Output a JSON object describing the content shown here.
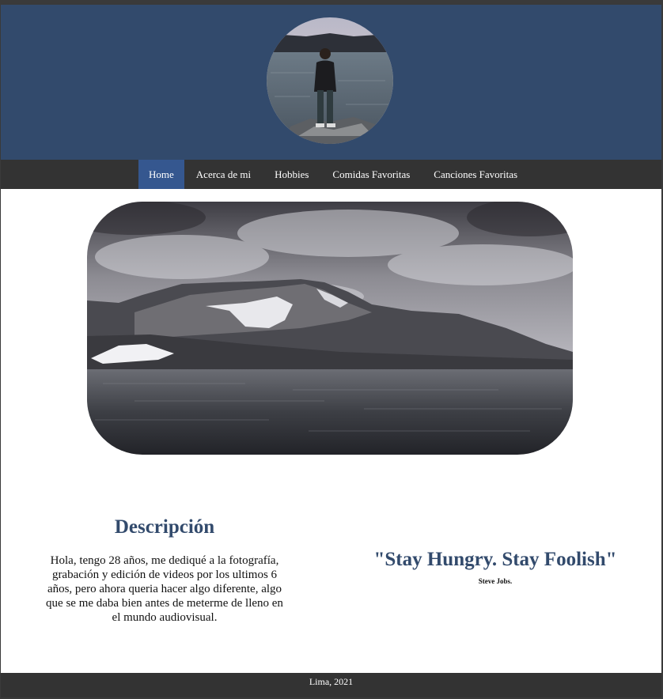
{
  "nav": {
    "items": [
      {
        "label": "Home",
        "active": true
      },
      {
        "label": "Acerca de mi",
        "active": false
      },
      {
        "label": "Hobbies",
        "active": false
      },
      {
        "label": "Comidas Favoritas",
        "active": false
      },
      {
        "label": "Canciones Favoritas",
        "active": false
      }
    ]
  },
  "description": {
    "title": "Descripción",
    "body": "Hola, tengo 28 años, me dediqué a la fotografía, grabación y edición de videos por los ultimos 6 años, pero ahora queria hacer algo diferente, algo que se me daba bien antes de meterme de lleno en el mundo audiovisual."
  },
  "quote": {
    "text": "\"Stay Hungry. Stay Foolish\"",
    "author": "Steve Jobs."
  },
  "footer": {
    "text": "Lima, 2021"
  },
  "colors": {
    "banner": "#324a6c",
    "menu_bar": "#333333",
    "menu_active": "#35578f",
    "heading": "#324a6c"
  }
}
